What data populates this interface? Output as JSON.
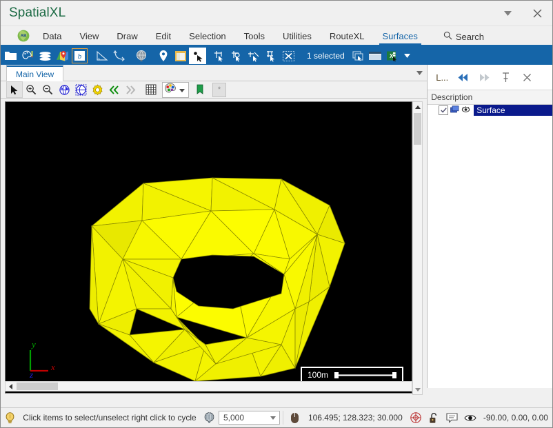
{
  "window": {
    "title": "SpatialXL",
    "app_icon": "globe-africa-icon",
    "dropdown_icon": "chevron-down-icon",
    "close_icon": "close-icon"
  },
  "menubar": {
    "items": [
      {
        "label": "Data",
        "active": false
      },
      {
        "label": "View",
        "active": false
      },
      {
        "label": "Draw",
        "active": false
      },
      {
        "label": "Edit",
        "active": false
      },
      {
        "label": "Selection",
        "active": false
      },
      {
        "label": "Tools",
        "active": false
      },
      {
        "label": "Utilities",
        "active": false
      },
      {
        "label": "RouteXL",
        "active": false
      },
      {
        "label": "Surfaces",
        "active": true
      }
    ],
    "search_label": "Search",
    "search_icon": "search-icon"
  },
  "ribbon": {
    "status_text": "1 selected",
    "accent_color": "#1565a8",
    "icons": [
      "open-folder-icon",
      "palette-tools-icon",
      "layers-stack-icon",
      "map-marker-map-icon",
      "boundary-icon",
      "measure-angle-icon",
      "coordinate-transform-icon",
      "globe-icon",
      "place-pin-icon",
      "map-window-icon",
      "select-point-cursor-icon",
      "move-selection-icon",
      "rotate-selection-icon",
      "add-selection-icon",
      "resize-selection-icon",
      "clear-selection-icon"
    ],
    "trailing_icons": [
      "copy-selection-icon",
      "table-report-icon",
      "export-excel-icon",
      "overflow-caret-icon"
    ]
  },
  "document": {
    "tab_label": "Main View",
    "tab_overflow_icon": "chevron-down-icon"
  },
  "view_toolbar": {
    "icons": [
      "pointer-select-icon",
      "zoom-in-icon",
      "zoom-out-icon",
      "zoom-extents-globe-icon",
      "zoom-previous-globe-icon",
      "view-settings-gear-icon",
      "step-back-icon",
      "step-forward-icon",
      "grid-icon",
      "color-palette-icon",
      "bookmark-flag-icon",
      "star-icon"
    ],
    "palette_caret_icon": "chevron-down-icon",
    "star_label": "*"
  },
  "viewport": {
    "background_color": "#000000",
    "surface_color": "#f2f200",
    "surface_name": "Surface",
    "scale_bar_label": "100m",
    "axes": [
      {
        "label": "y",
        "color": "#00a000"
      },
      {
        "label": "x",
        "color": "#c00000"
      },
      {
        "label": "z",
        "color": "#0000d0"
      }
    ],
    "scrollbars": {
      "vertical_up_icon": "caret-up-icon",
      "vertical_down_icon": "caret-down-icon",
      "horizontal_left_icon": "caret-left-icon"
    }
  },
  "right_panel": {
    "title": "L...",
    "buttons": [
      "nav-back-icon",
      "nav-forward-icon",
      "pin-icon",
      "close-icon"
    ],
    "column_header": "Description",
    "rows": [
      {
        "label": "Surface",
        "checked": true,
        "selected": true,
        "layer_icon": "layers-icon",
        "visibility_icon": "visibility-eye-icon"
      }
    ]
  },
  "statusbar": {
    "hint_icon": "lightbulb-icon",
    "hint_text": "Click items to select/unselect right click to cycle",
    "projection_icon": "globe-wire-icon",
    "scale_value": "5,000",
    "scale_caret_icon": "chevron-down-icon",
    "mouse_icon": "mouse-icon",
    "coordinates": "106.495; 128.323; 30.000",
    "snap_icon": "snap-target-icon",
    "lock_icon": "unlocked-padlock-icon",
    "message_icon": "message-icon",
    "eye_icon": "eye-icon",
    "view_angles": "-90.00, 0.00, 0.00"
  }
}
